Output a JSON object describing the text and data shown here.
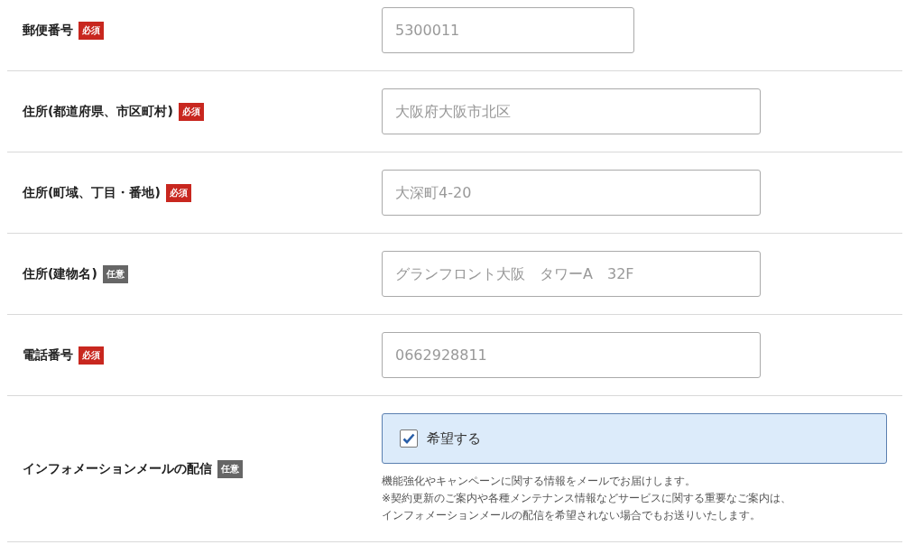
{
  "fields": [
    {
      "kind": "short-text",
      "label": "郵便番号",
      "badge": {
        "kind": "required",
        "text": "必須"
      },
      "placeholder": "5300011"
    },
    {
      "kind": "text",
      "label": "住所(都道府県、市区町村)",
      "badge": {
        "kind": "required",
        "text": "必須"
      },
      "placeholder": "大阪府大阪市北区"
    },
    {
      "kind": "text",
      "label": "住所(町域、丁目・番地)",
      "badge": {
        "kind": "required",
        "text": "必須"
      },
      "placeholder": "大深町4-20"
    },
    {
      "kind": "text",
      "label": "住所(建物名)",
      "badge": {
        "kind": "optional",
        "text": "任意"
      },
      "placeholder": "グランフロント大阪　タワーA　32F"
    },
    {
      "kind": "text",
      "label": "電話番号",
      "badge": {
        "kind": "required",
        "text": "必須"
      },
      "placeholder": "0662928811"
    },
    {
      "kind": "checkbox",
      "label": "インフォメーションメールの配信",
      "badge": {
        "kind": "optional",
        "text": "任意"
      },
      "option": "希望する",
      "checked": true,
      "notes": [
        "機能強化やキャンペーンに関する情報をメールでお届けします。",
        "※契約更新のご案内や各種メンテナンス情報などサービスに関する重要なご案内は、",
        "インフォメーションメールの配信を希望されない場合でもお送りいたします。"
      ]
    }
  ]
}
